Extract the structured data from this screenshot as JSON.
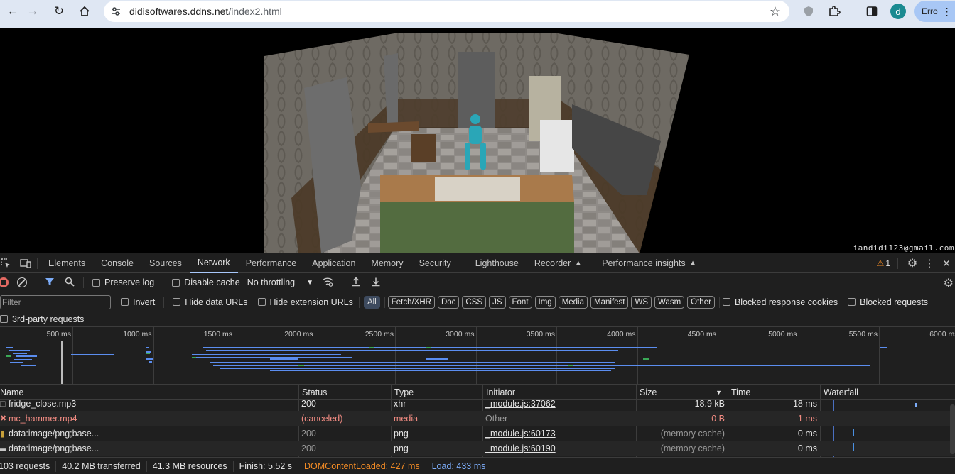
{
  "browser": {
    "url_host": "didisoftwares.ddns.net",
    "url_path": "/index2.html",
    "avatar_letter": "d",
    "error_label": "Erro"
  },
  "page": {
    "watermark": "iandidi123@gmail.com"
  },
  "devtools": {
    "tabs": [
      "Elements",
      "Console",
      "Sources",
      "Network",
      "Performance",
      "Application",
      "Memory",
      "Security",
      "Lighthouse",
      "Recorder",
      "Performance insights"
    ],
    "active_tab": "Network",
    "warning_count": "1",
    "toolbar": {
      "preserve_log": "Preserve log",
      "disable_cache": "Disable cache",
      "throttling": "No throttling"
    },
    "filter": {
      "placeholder": "Filter",
      "invert": "Invert",
      "hide_data_urls": "Hide data URLs",
      "hide_extension_urls": "Hide extension URLs",
      "types": [
        "All",
        "Fetch/XHR",
        "Doc",
        "CSS",
        "JS",
        "Font",
        "Img",
        "Media",
        "Manifest",
        "WS",
        "Wasm",
        "Other"
      ],
      "blocked_response_cookies": "Blocked response cookies",
      "blocked_requests": "Blocked requests",
      "third_party": "3rd-party requests"
    },
    "overview_ticks": [
      "500 ms",
      "1000 ms",
      "1500 ms",
      "2000 ms",
      "2500 ms",
      "3000 ms",
      "3500 ms",
      "4000 ms",
      "4500 ms",
      "5000 ms",
      "5500 ms",
      "6000 ms"
    ],
    "columns": {
      "name": "Name",
      "status": "Status",
      "type": "Type",
      "initiator": "Initiator",
      "size": "Size",
      "time": "Time",
      "waterfall": "Waterfall"
    },
    "rows": [
      {
        "name": "fridge_close.mp3",
        "status": "200",
        "type": "xhr",
        "initiator": "_module.js:37062",
        "size": "18.9 kB",
        "time": "18 ms"
      },
      {
        "name": "mc_hammer.mp4",
        "status": "(canceled)",
        "type": "media",
        "initiator": "Other",
        "size": "0 B",
        "time": "1 ms"
      },
      {
        "name": "data:image/png;base...",
        "status": "200",
        "type": "png",
        "initiator": "_module.js:60173",
        "size": "(memory cache)",
        "time": "0 ms"
      },
      {
        "name": "data:image/png;base...",
        "status": "200",
        "type": "png",
        "initiator": "_module.js:60190",
        "size": "(memory cache)",
        "time": "0 ms"
      }
    ],
    "status": {
      "requests": "103 requests",
      "transferred": "40.2 MB transferred",
      "resources": "41.3 MB resources",
      "finish": "Finish: 5.52 s",
      "dom_loaded": "DOMContentLoaded: 427 ms",
      "load": "Load: 433 ms"
    }
  }
}
